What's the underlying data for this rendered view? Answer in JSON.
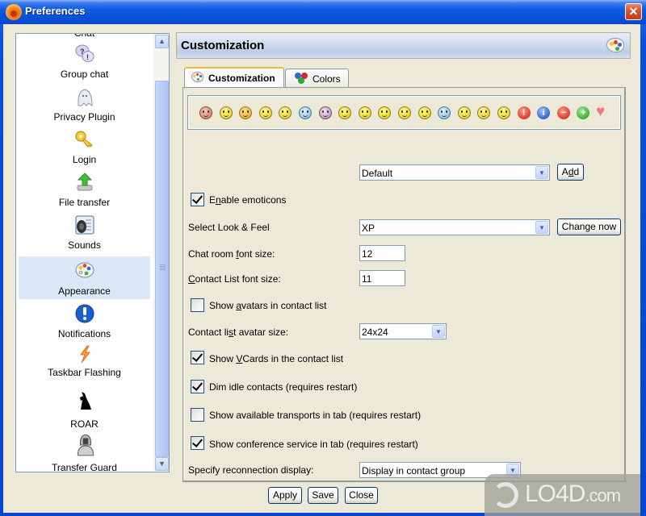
{
  "window": {
    "title": "Preferences",
    "close_label": "✕"
  },
  "sidebar": {
    "partial_top_label": "Chat",
    "items": [
      {
        "label": "Group chat",
        "icon": "group-chat-icon",
        "selected": false
      },
      {
        "label": "Privacy Plugin",
        "icon": "ghost-icon",
        "selected": false
      },
      {
        "label": "Login",
        "icon": "key-icon",
        "selected": false
      },
      {
        "label": "File transfer",
        "icon": "upload-arrow-icon",
        "selected": false
      },
      {
        "label": "Sounds",
        "icon": "speaker-icon",
        "selected": false
      },
      {
        "label": "Appearance",
        "icon": "palette-icon",
        "selected": true
      },
      {
        "label": "Notifications",
        "icon": "exclamation-icon",
        "selected": false
      },
      {
        "label": "Taskbar Flashing",
        "icon": "lightning-icon",
        "selected": false
      },
      {
        "label": "ROAR",
        "icon": "wolf-icon",
        "selected": false
      },
      {
        "label": "Transfer Guard",
        "icon": "knight-helmet-icon",
        "selected": false
      }
    ],
    "scroll_up": "▲",
    "scroll_down": "▼"
  },
  "header": {
    "title": "Customization"
  },
  "tabs": [
    {
      "label": "Customization",
      "active": true
    },
    {
      "label": "Colors",
      "active": false
    }
  ],
  "emoticons": [
    "angry",
    "wink",
    "smile",
    "confused",
    "cool",
    "crying",
    "devil",
    "grin",
    "happy",
    "laugh",
    "love",
    "surprised",
    "sad",
    "neutral",
    "shocked",
    "tongue",
    "alert",
    "info",
    "minus",
    "plus",
    "heart"
  ],
  "symbols": {
    "alert": "!",
    "info": "i",
    "minus": "−",
    "plus": "+",
    "heart": "♥"
  },
  "form": {
    "emoticon_set": {
      "value": "Default",
      "button": "Add",
      "button_mnemonic": "d"
    },
    "enable_emoticons": {
      "label_pre": "E",
      "label_mn": "n",
      "label_post": "able emoticons",
      "checked": true
    },
    "look_feel": {
      "label": "Select Look & Feel",
      "value": "XP",
      "button": "Change now"
    },
    "chat_font": {
      "label_pre": "Chat room ",
      "label_mn": "f",
      "label_post": "ont size:",
      "value": "12"
    },
    "contact_font": {
      "label_mn": "C",
      "label_post": "ontact List font size:",
      "value": "11"
    },
    "show_avatars": {
      "label_pre": "Show ",
      "label_mn": "a",
      "label_post": "vatars in contact list",
      "checked": false
    },
    "avatar_size": {
      "label_pre": "Contact li",
      "label_mn": "s",
      "label_post": "t avatar size:",
      "value": "24x24"
    },
    "show_vcards": {
      "label_pre": "Show ",
      "label_mn": "V",
      "label_post": "Cards in the contact list",
      "checked": true
    },
    "dim_idle": {
      "label": "Dim idle contacts (requires restart)",
      "checked": true
    },
    "show_transports": {
      "label": "Show available transports in tab (requires restart)",
      "checked": false
    },
    "show_conference": {
      "label": "Show conference service in tab (requires restart)",
      "checked": true
    },
    "reconnection": {
      "label": "Specify reconnection display:",
      "value": "Display in contact group"
    }
  },
  "footer": {
    "apply": "Apply",
    "save": "Save",
    "close": "Close"
  },
  "watermark": {
    "text": "LO4D",
    "suffix": ".com"
  }
}
